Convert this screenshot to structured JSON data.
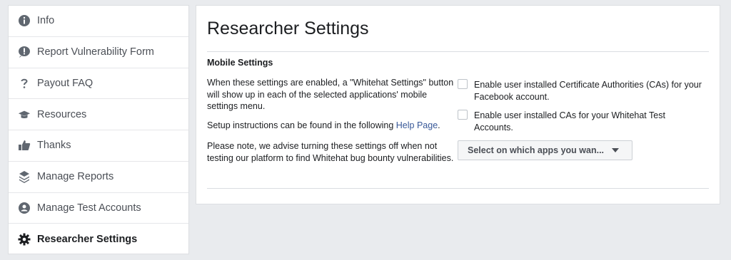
{
  "sidebar": {
    "items": [
      {
        "label": "Info",
        "icon": "info-icon"
      },
      {
        "label": "Report Vulnerability Form",
        "icon": "alert-icon"
      },
      {
        "label": "Payout FAQ",
        "icon": "question-icon"
      },
      {
        "label": "Resources",
        "icon": "graduation-cap-icon"
      },
      {
        "label": "Thanks",
        "icon": "thumbs-up-icon"
      },
      {
        "label": "Manage Reports",
        "icon": "layers-icon"
      },
      {
        "label": "Manage Test Accounts",
        "icon": "account-icon"
      },
      {
        "label": "Researcher Settings",
        "icon": "gear-icon",
        "active": true
      }
    ]
  },
  "main": {
    "title": "Researcher Settings",
    "section_title": "Mobile Settings",
    "description_1": "When these settings are enabled, a \"Whitehat Settings\" button will show up in each of the selected applications' mobile settings menu.",
    "description_2_prefix": "Setup instructions can be found in the following ",
    "description_2_link": "Help Page",
    "description_2_suffix": ".",
    "description_3": "Please note, we advise turning these settings off when not testing our platform to find Whitehat bug bounty vulnerabilities.",
    "checkbox_1_label": "Enable user installed Certificate Authorities (CAs) for your Facebook account.",
    "checkbox_1_checked": false,
    "checkbox_2_label": "Enable user installed CAs for your Whitehat Test Accounts.",
    "checkbox_2_checked": false,
    "select_label": "Select on which apps you wan..."
  },
  "colors": {
    "background": "#e9ebee",
    "link": "#385898",
    "icon": "#606770"
  }
}
